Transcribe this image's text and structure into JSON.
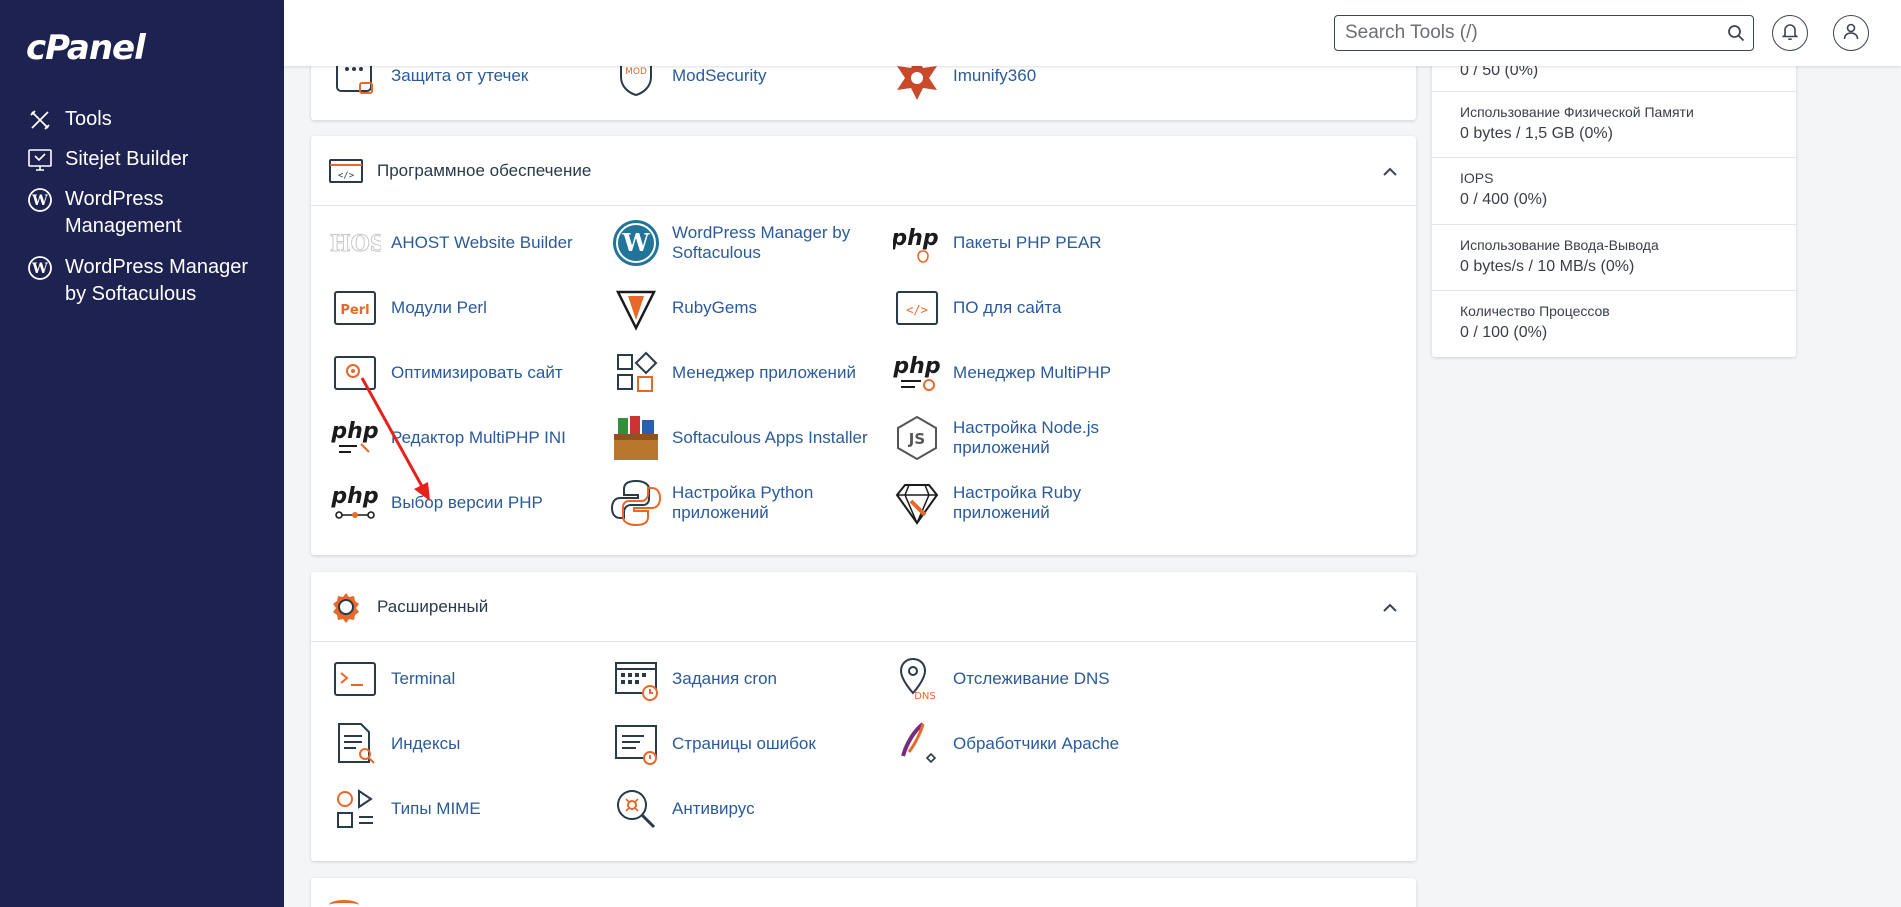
{
  "brand": {
    "logo_text": "cPanel"
  },
  "sidebar": {
    "items": [
      {
        "label": "Tools",
        "icon": "tools-icon"
      },
      {
        "label": "Sitejet Builder",
        "icon": "sitejet-icon"
      },
      {
        "label": "WordPress Management",
        "icon": "wordpress-icon"
      },
      {
        "label": "WordPress Manager by Softaculous",
        "icon": "wordpress-icon"
      }
    ]
  },
  "header": {
    "search_placeholder": "Search Tools (/)",
    "notifications_icon": "bell-icon",
    "user_icon": "user-icon"
  },
  "security_card": {
    "tools": [
      {
        "label": "Защита от утечек",
        "icon": "leak-protection-icon"
      },
      {
        "label": "ModSecurity",
        "icon": "modsecurity-icon"
      },
      {
        "label": "Imunify360",
        "icon": "imunify-icon"
      }
    ]
  },
  "software_card": {
    "title": "Программное обеспечение",
    "tools": [
      {
        "label": "AHOST Website Builder",
        "icon": "ahost-icon"
      },
      {
        "label": "WordPress Manager by Softaculous",
        "icon": "wordpress-icon"
      },
      {
        "label": "Пакеты PHP PEAR",
        "icon": "php-pear-icon"
      },
      {
        "label": "Модули Perl",
        "icon": "perl-icon"
      },
      {
        "label": "RubyGems",
        "icon": "rubygems-icon"
      },
      {
        "label": "ПО для сайта",
        "icon": "site-software-icon"
      },
      {
        "label": "Оптимизировать сайт",
        "icon": "optimize-icon"
      },
      {
        "label": "Менеджер приложений",
        "icon": "app-manager-icon"
      },
      {
        "label": "Менеджер MultiPHP",
        "icon": "multiphp-manager-icon"
      },
      {
        "label": "Редактор MultiPHP INI",
        "icon": "multiphp-ini-icon"
      },
      {
        "label": "Softaculous Apps Installer",
        "icon": "softaculous-icon"
      },
      {
        "label": "Настройка Node.js приложений",
        "icon": "nodejs-icon"
      },
      {
        "label": "Выбор версии PHP",
        "icon": "php-version-icon"
      },
      {
        "label": "Настройка Python приложений",
        "icon": "python-icon"
      },
      {
        "label": "Настройка Ruby приложений",
        "icon": "ruby-icon"
      }
    ]
  },
  "advanced_card": {
    "title": "Расширенный",
    "tools": [
      {
        "label": "Terminal",
        "icon": "terminal-icon"
      },
      {
        "label": "Задания cron",
        "icon": "cron-icon"
      },
      {
        "label": "Отслеживание DNS",
        "icon": "dns-icon"
      },
      {
        "label": "Индексы",
        "icon": "indexes-icon"
      },
      {
        "label": "Страницы ошибок",
        "icon": "error-pages-icon"
      },
      {
        "label": "Обработчики Apache",
        "icon": "apache-icon"
      },
      {
        "label": "Типы MIME",
        "icon": "mime-icon"
      },
      {
        "label": "Антивирус",
        "icon": "antivirus-icon"
      }
    ]
  },
  "stats": {
    "items": [
      {
        "label": "",
        "value": "0 / 50   (0%)"
      },
      {
        "label": "Использование Физической Памяти",
        "value": "0 bytes / 1,5 GB   (0%)"
      },
      {
        "label": "IOPS",
        "value": "0 / 400   (0%)"
      },
      {
        "label": "Использование Ввода-Вывода",
        "value": "0 bytes/s / 10 MB/s   (0%)"
      },
      {
        "label": "Количество Процессов",
        "value": "0 / 100   (0%)"
      }
    ]
  },
  "colors": {
    "sidebar_bg": "#1d2250",
    "link": "#2b5a9b",
    "accent": "#e8682a",
    "annotation_arrow": "#e8201c"
  }
}
